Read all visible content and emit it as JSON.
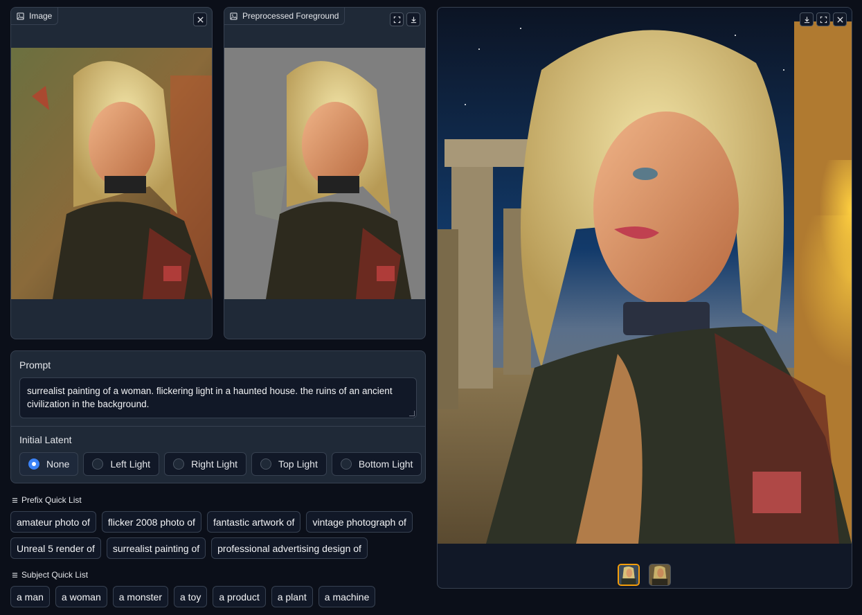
{
  "input_image": {
    "label": "Image"
  },
  "preprocessed": {
    "label": "Preprocessed Foreground"
  },
  "prompt": {
    "label": "Prompt",
    "value": "surrealist painting of a woman. flickering light in a haunted house. the ruins of an ancient civilization in the background."
  },
  "initial_latent": {
    "label": "Initial Latent",
    "selected": "None",
    "options": [
      "None",
      "Left Light",
      "Right Light",
      "Top Light",
      "Bottom Light"
    ]
  },
  "prefix_list": {
    "title": "Prefix Quick List",
    "row1": [
      "amateur photo of",
      "flicker 2008 photo of",
      "fantastic artwork of",
      "vintage photograph of"
    ],
    "row2": [
      "Unreal 5 render of",
      "surrealist painting of",
      "professional advertising design of"
    ]
  },
  "subject_list": {
    "title": "Subject Quick List",
    "items": [
      "a man",
      "a woman",
      "a monster",
      "a toy",
      "a product",
      "a plant",
      "a machine"
    ]
  },
  "colors": {
    "accent": "#3b82f6",
    "thumb_selected": "#f59e0b",
    "background": "#0b0f19",
    "panel": "#1f2937"
  }
}
